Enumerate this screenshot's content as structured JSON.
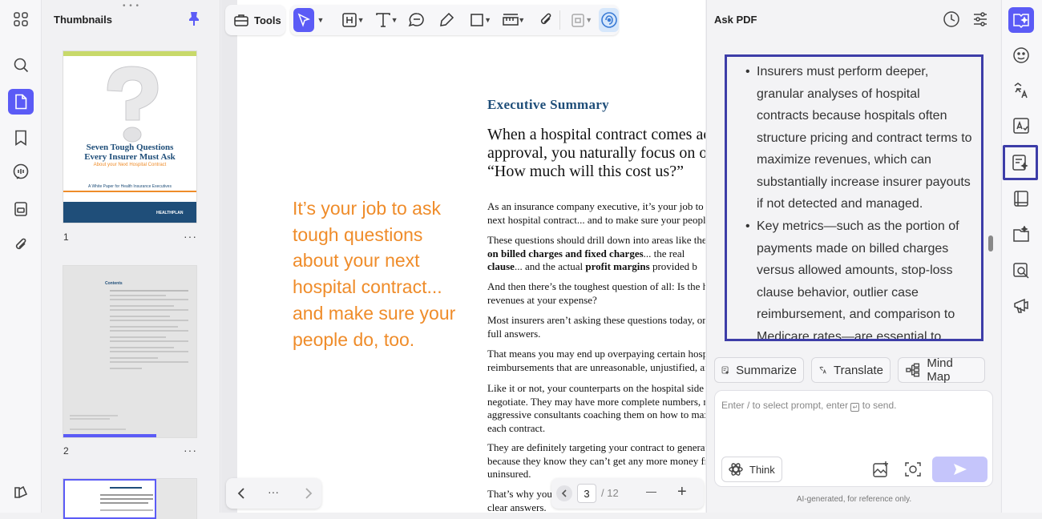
{
  "thumbnails": {
    "title": "Thumbnails",
    "pages": [
      {
        "number": "1"
      },
      {
        "number": "2"
      }
    ],
    "cover": {
      "title_line1": "Seven Tough Questions",
      "title_line2": "Every Insurer Must Ask",
      "subtitle": "About your Next Hospital Contract",
      "tagline": "A White Paper for Health Insurance Executives",
      "logo": "HEALTHPLAN"
    },
    "contents_title": "Contents"
  },
  "toolbar": {
    "tools_label": "Tools"
  },
  "document": {
    "exec_title": "Executive Summary",
    "lead": "When a hospital contract comes acro\napproval, you naturally focus on one a\n“How much will this cost us?”",
    "pull_quote": "It’s your job to ask tough questions about your next hospital contract... and make sure your people do, too.",
    "para1": "As an insurance company executive, it’s your job to a\nnext hospital contract... and to make sure your peopl",
    "para2_line1": "These questions should drill down into areas like the",
    "para2_b1": "on billed charges and fixed charges",
    "para2_t1": "... the real",
    "para2_b2": "clause",
    "para2_t2": "... and the actual ",
    "para2_b3": "profit margins",
    "para2_t3": " provided b",
    "para3": "And then there’s the toughest question of all: Is the h\nrevenues at your expense?",
    "para4": "Most insurers aren’t asking these questions today, or\nfull answers.",
    "para5": "That means you may end up overpaying certain hospi\nreimbursements that are unreasonable, unjustified, an",
    "para6": "Like it or not, your counterparts on the hospital side\nnegotiate. They may have more complete numbers, m\naggressive consultants coaching them on how to max\neach contract.",
    "para7": "They are definitely targeting your contract to generat\nbecause they know they can’t get any more money fr\nuninsured.",
    "para8": "That’s why you ow\nclear answers."
  },
  "pager": {
    "more": "···",
    "current_page": "3",
    "total": "/ 12",
    "zoom_out": "—",
    "zoom_in": "+"
  },
  "ask_pdf": {
    "title": "Ask PDF",
    "bullets": [
      "Insurers must perform deeper, granular analyses of hospital contracts because hospitals often structure pricing and contract terms to maximize revenues, which can substantially increase insurer payouts if not detected and managed.",
      "Key metrics—such as the portion of payments made on billed charges versus allowed amounts, stop-loss clause behavior, outlier case reimbursement, and comparison to Medicare rates—are essential to"
    ],
    "actions": {
      "summarize": "Summarize",
      "translate": "Translate",
      "mind_map": "Mind Map"
    },
    "prompt_placeholder_pre": "Enter / to select prompt, enter",
    "prompt_placeholder_post": "to send.",
    "think_label": "Think",
    "footnote": "AI-generated, for reference only."
  },
  "colors": {
    "accent": "#5b5bf6",
    "highlight_border": "#3d3da8",
    "pull_quote": "#ef8c2a",
    "exec_title": "#1f4e79"
  }
}
